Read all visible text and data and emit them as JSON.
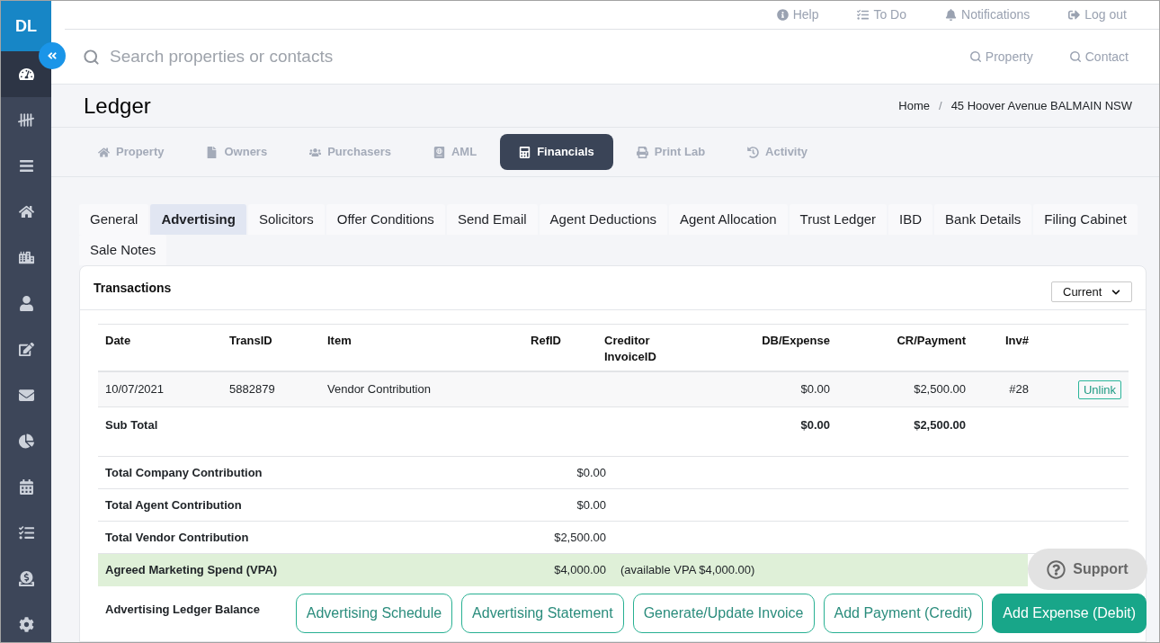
{
  "sidebar": {
    "initials": "DL",
    "items": [
      {
        "selected": true
      },
      {
        "selected": false
      },
      {
        "selected": false
      },
      {
        "selected": false
      },
      {
        "selected": false
      },
      {
        "selected": false
      },
      {
        "selected": false
      },
      {
        "selected": false
      },
      {
        "selected": false
      },
      {
        "selected": false
      },
      {
        "selected": false
      },
      {
        "selected": false
      },
      {
        "selected": false
      }
    ]
  },
  "top_links": [
    {
      "label": "Help"
    },
    {
      "label": "To Do"
    },
    {
      "label": "Notifications"
    },
    {
      "label": "Log out"
    }
  ],
  "search": {
    "placeholder": "Search properties or contacts",
    "scopes": [
      {
        "label": "Property"
      },
      {
        "label": "Contact"
      }
    ]
  },
  "header": {
    "title": "Ledger",
    "breadcrumb": [
      {
        "label": "Home"
      },
      {
        "label": "45 Hoover Avenue BALMAIN NSW"
      }
    ],
    "breadcrumb_separator": "/"
  },
  "main_tabs": [
    {
      "label": "Property",
      "selected": false
    },
    {
      "label": "Owners",
      "selected": false
    },
    {
      "label": "Purchasers",
      "selected": false
    },
    {
      "label": "AML",
      "selected": false
    },
    {
      "label": "Financials",
      "selected": true
    },
    {
      "label": "Print Lab",
      "selected": false
    },
    {
      "label": "Activity",
      "selected": false
    }
  ],
  "sub_tabs": [
    {
      "label": "General",
      "selected": false
    },
    {
      "label": "Advertising",
      "selected": true
    },
    {
      "label": "Solicitors",
      "selected": false
    },
    {
      "label": "Offer Conditions",
      "selected": false
    },
    {
      "label": "Send Email",
      "selected": false
    },
    {
      "label": "Agent Deductions",
      "selected": false
    },
    {
      "label": "Agent Allocation",
      "selected": false
    },
    {
      "label": "Trust Ledger",
      "selected": false
    },
    {
      "label": "IBD",
      "selected": false
    },
    {
      "label": "Bank Details",
      "selected": false
    },
    {
      "label": "Filing Cabinet",
      "selected": false
    },
    {
      "label": "Sale Notes",
      "selected": false
    }
  ],
  "transactions": {
    "title": "Transactions",
    "filter": {
      "value": "Current"
    },
    "table": {
      "columns": [
        "Date",
        "TransID",
        "Item",
        "RefID",
        "Creditor InvoiceID",
        "DB/Expense",
        "CR/Payment",
        "Inv#"
      ],
      "rows": [
        {
          "date": "10/07/2021",
          "trans_id": "5882879",
          "item": "Vendor Contribution",
          "db_expense": "$0.00",
          "cr_payment": "$2,500.00",
          "inv": "#28",
          "action": "Unlink"
        }
      ],
      "subtotal": {
        "label": "Sub Total",
        "db_expense": "$0.00",
        "cr_payment": "$2,500.00"
      }
    },
    "summary": [
      {
        "label": "Total Company Contribution",
        "value": "$0.00",
        "highlighted": false
      },
      {
        "label": "Total Agent Contribution",
        "value": "$0.00",
        "highlighted": false
      },
      {
        "label": "Total Vendor Contribution",
        "value": "$2,500.00",
        "highlighted": false
      },
      {
        "label": "Agreed Marketing Spend (VPA)",
        "value": "$4,000.00",
        "note": "(available VPA $4,000.00)",
        "highlighted": true
      }
    ],
    "balance": {
      "label": "Advertising Ledger Balance"
    },
    "actions": [
      {
        "label": "Advertising Schedule",
        "primary": false
      },
      {
        "label": "Advertising Statement",
        "primary": false
      },
      {
        "label": "Generate/Update Invoice",
        "primary": false
      },
      {
        "label": "Add Payment (Credit)",
        "primary": false
      },
      {
        "label": "Add Expense (Debit)",
        "primary": true
      }
    ]
  },
  "support": {
    "label": "Support"
  }
}
